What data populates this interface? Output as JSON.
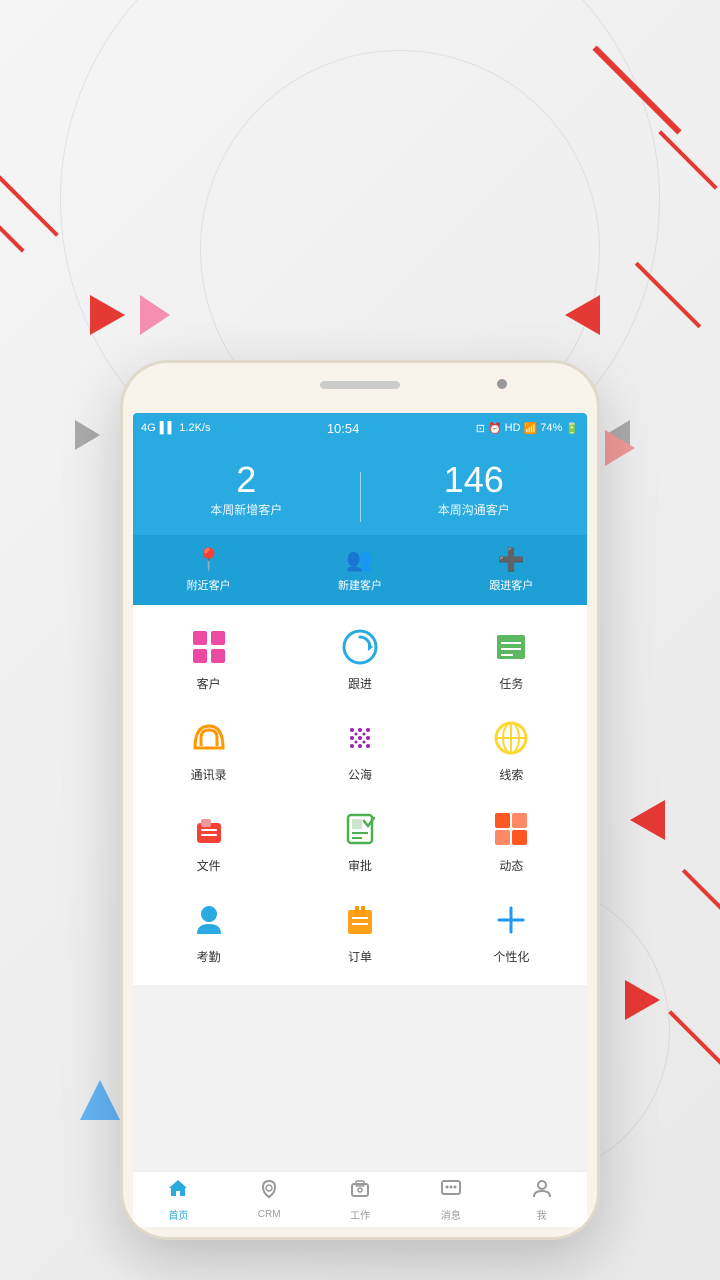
{
  "background": {
    "color": "#f0f0f0"
  },
  "status_bar": {
    "network": "4G",
    "signal": "il",
    "speed": "1.2K/s",
    "time": "10:54",
    "battery": "74%",
    "hd": "HD"
  },
  "header": {
    "stat1_number": "2",
    "stat1_label": "本周新增客户",
    "stat2_number": "146",
    "stat2_label": "本周沟通客户"
  },
  "quick_actions": [
    {
      "icon": "📍",
      "label": "附近客户"
    },
    {
      "icon": "👥",
      "label": "新建客户"
    },
    {
      "icon": "➕",
      "label": "跟进客户"
    }
  ],
  "app_grid": [
    [
      {
        "label": "客户",
        "color": "#e91e8c"
      },
      {
        "label": "跟进",
        "color": "#29aae1"
      },
      {
        "label": "任务",
        "color": "#4caf50"
      }
    ],
    [
      {
        "label": "通讯录",
        "color": "#ff9800"
      },
      {
        "label": "公海",
        "color": "#9c27b0"
      },
      {
        "label": "线索",
        "color": "#fdd835"
      }
    ],
    [
      {
        "label": "文件",
        "color": "#f44336"
      },
      {
        "label": "审批",
        "color": "#4caf50"
      },
      {
        "label": "动态",
        "color": "#ff5722"
      }
    ],
    [
      {
        "label": "考勤",
        "color": "#29aae1"
      },
      {
        "label": "订单",
        "color": "#ff9800"
      },
      {
        "label": "个性化",
        "color": "#2196f3"
      }
    ]
  ],
  "bottom_nav": [
    {
      "label": "首页",
      "active": true
    },
    {
      "label": "CRM",
      "active": false
    },
    {
      "label": "工作",
      "active": false
    },
    {
      "label": "消息",
      "active": false
    },
    {
      "label": "我",
      "active": false
    }
  ]
}
